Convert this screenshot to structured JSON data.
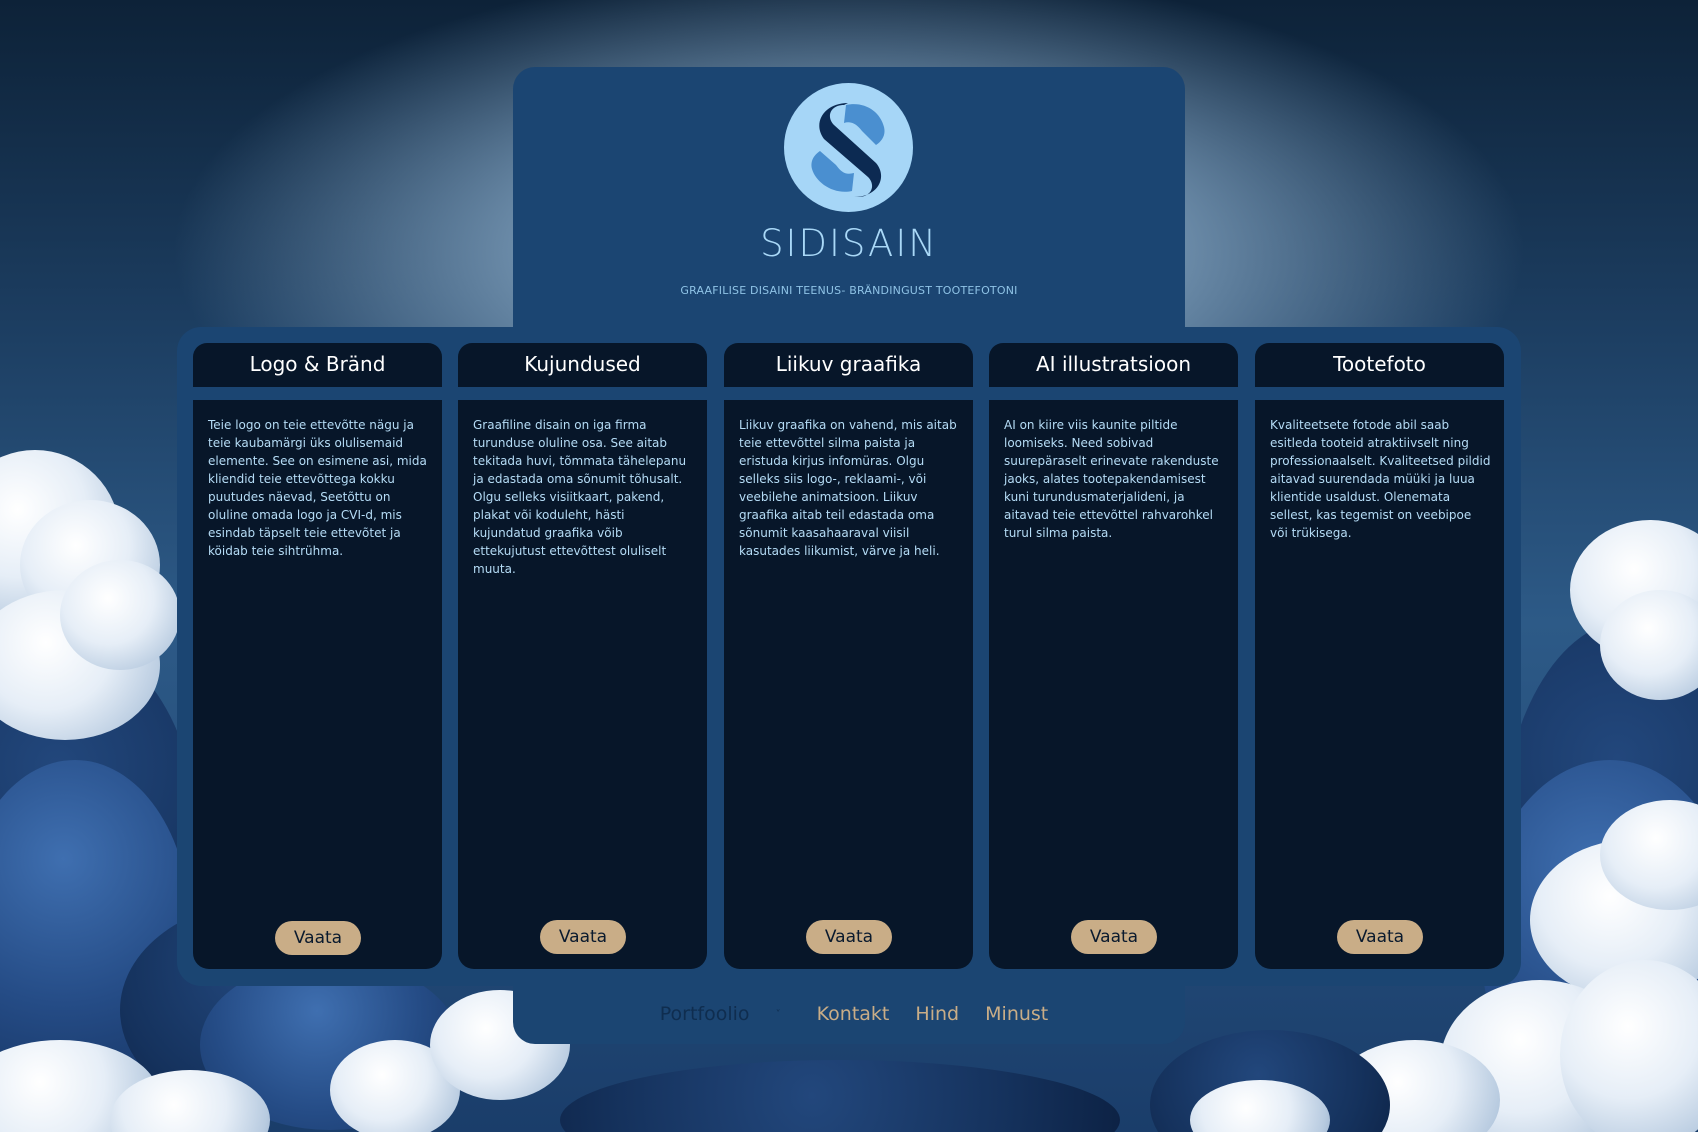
{
  "brand": {
    "name": "SIDISAIN",
    "tagline": "GRAAFILISE DISAINI TEENUS- BRÄNDINGUST TOOTEFOTONI",
    "logo_icon": "s-logo-icon",
    "colors": {
      "panel": "#1b4572",
      "card": "#071629",
      "accent": "#a9d8f7",
      "button": "#c9ad87"
    }
  },
  "cards": [
    {
      "title": "Logo & Bränd",
      "text": "Teie logo on teie ettevõtte nägu ja teie kaubamärgi üks olulisemaid elemente. See on esimene asi, mida kliendid teie ettevõttega kokku puutudes näevad,  Seetõttu on oluline omada logo ja CVI-d, mis esindab täpselt teie ettevõtet ja köidab teie sihtrühma.",
      "button": "Vaata"
    },
    {
      "title": "Kujundused",
      "text": "Graafiline disain on iga firma turunduse oluline osa. See aitab tekitada huvi, tõmmata tähelepanu ja edastada oma sõnumit tõhusalt. Olgu selleks visiitkaart, pakend, plakat või koduleht, hästi kujundatud graafika võib ettekujutust ettevõttest oluliselt muuta.",
      "button": "Vaata"
    },
    {
      "title": "Liikuv graafika",
      "text": "Liikuv graafika on vahend, mis aitab teie ettevõttel silma paista ja eristuda kirjus infomüras. Olgu selleks siis logo-, reklaami-, või veebilehe animatsioon. Liikuv graafika aitab teil edastada oma sõnumit kaasahaaraval viisil kasutades liikumist, värve ja heli.",
      "button": "Vaata"
    },
    {
      "title": "AI illustratsioon",
      "text": "AI on kiire viis kaunite piltide loomiseks. Need sobivad suurepäraselt erinevate rakenduste jaoks, alates tootepakendamisest kuni turundusmaterjalideni, ja aitavad teie ettevõttel rahvarohkel turul silma paista.",
      "button": "Vaata"
    },
    {
      "title": "Tootefoto",
      "text": "Kvaliteetsete fotode abil saab esitleda tooteid atraktiivselt ning professionaalselt. Kvaliteetsed pildid aitavad suurendada müüki ja luua klientide usaldust. Olenemata sellest, kas tegemist on veebipoe või trükisega.",
      "button": "Vaata"
    }
  ],
  "nav": {
    "portfolio": "Portfoolio",
    "portfolio_chevron": "˅",
    "contact": "Kontakt",
    "price": "Hind",
    "about": "Minust"
  }
}
